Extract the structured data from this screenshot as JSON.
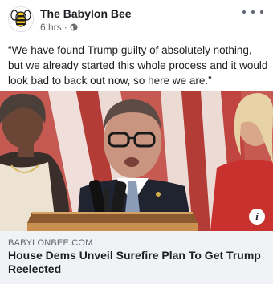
{
  "post": {
    "page_name": "The Babylon Bee",
    "timestamp": "6 hrs",
    "separator": "·",
    "privacy_icon": "globe-icon",
    "more_icon": "more-options-icon",
    "text": "“We have found Trump guilty of absolutely nothing, but we already started this whole process and it would look bad to back out now, so here we are.”"
  },
  "image": {
    "description_icon": "info-icon",
    "info_label": "i"
  },
  "link_preview": {
    "domain": "BABYLONBEE.COM",
    "title": "House Dems Unveil Surefire Plan To Get Trump Reelected"
  },
  "colors": {
    "text": "#1c1e21",
    "secondary_text": "#65676b",
    "preview_bg": "#f0f2f5",
    "logo_yellow": "#f5c518"
  }
}
